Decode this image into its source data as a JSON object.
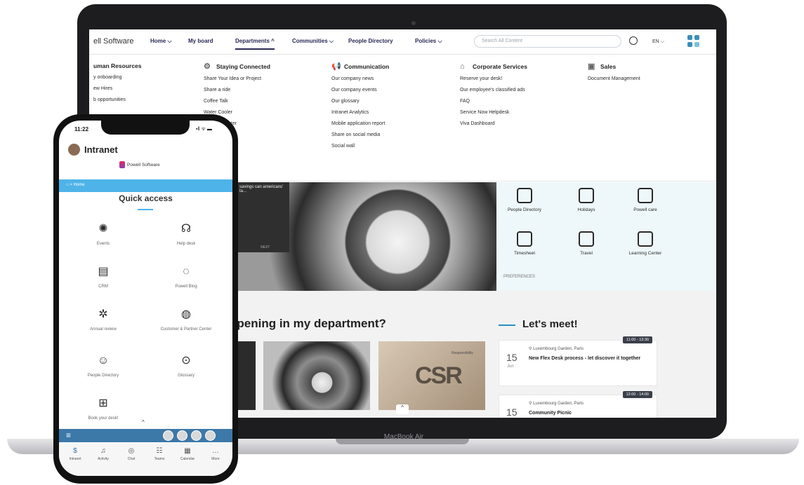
{
  "laptop": {
    "label": "MacBook Air",
    "nav": {
      "brand": "ell Software",
      "items": [
        "Home ⌵",
        "My board",
        "Departments ^",
        "Communities ⌵",
        "People Directory",
        "Policies ⌵"
      ],
      "search_placeholder": "Search All Content",
      "lang": "EN ⌵"
    },
    "menu": {
      "columns": [
        {
          "heading": "uman Resources",
          "items": [
            "y onboarding",
            "ew Hires",
            "b opportunities"
          ]
        },
        {
          "heading": "Staying Connected",
          "items": [
            "Share Your Idea or Project",
            "Share a ride",
            "Coffee Talk",
            "Water Cooler",
            "plication center",
            "ay Calendar"
          ]
        },
        {
          "heading": "Communication",
          "items": [
            "Our company news",
            "Our company events",
            "Our glossary",
            "Intranet Analytics",
            "Mobile application report",
            "Share on social media",
            "Social wall"
          ]
        },
        {
          "heading": "Corporate Services",
          "items": [
            "Reserve your desk!",
            "Our employee's classified ads",
            "FAQ",
            "Service Now Helpdesk",
            "Viva Dashboard"
          ]
        },
        {
          "heading": "Sales",
          "items": [
            "Document Management"
          ]
        }
      ]
    },
    "hero_snippet": "savings can americans' ta...",
    "hero_next": "NEXT",
    "quick": [
      "People Directory",
      "Holidays",
      "Powell care",
      "Timesheet",
      "Travel",
      "Learning Center"
    ],
    "preferences": "PREFERENCES",
    "happening_title": "ppening in my department?",
    "card_csr": "CSR",
    "card_resp": "Responsibility",
    "meet_title": "Let's meet!",
    "events": [
      {
        "day": "15",
        "month": "Jun",
        "location": "Luxembourg Garden, Paris",
        "title": "New Flex Desk process - let discover it together",
        "time": "11:00 - 13:30"
      },
      {
        "day": "15",
        "month": "",
        "location": "Luxembourg Garden, Paris",
        "title": "Community Picnic",
        "time": "12:00 - 14:00"
      }
    ]
  },
  "phone": {
    "time": "11:22",
    "status": "▪ll ᯤ ▬",
    "title": "Intranet",
    "logo_text": "Powell Software",
    "breadcrumb": "⌂  >  Home",
    "quick_access_title": "Quick access",
    "tiles": [
      "Events",
      "Help desk",
      "CRM",
      "Powell Blog",
      "Annual review",
      "Customer & Partner Center",
      "People Directory",
      "Glossary",
      "Book your desk!"
    ],
    "tabs": [
      "Intranet",
      "Activity",
      "Chat",
      "Teams",
      "Calendar",
      "More"
    ]
  }
}
